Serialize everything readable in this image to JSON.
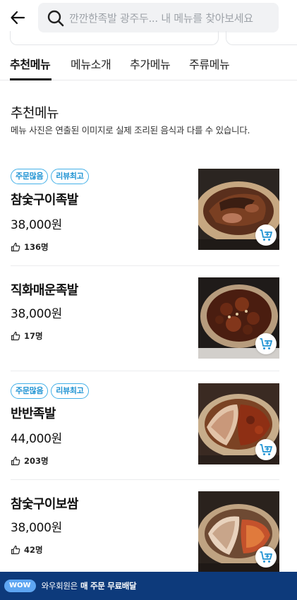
{
  "header": {
    "search_placeholder": "깐깐한족발 광주두... 내 메뉴를 찾아보세요"
  },
  "tabs": [
    {
      "label": "추천메뉴",
      "active": true
    },
    {
      "label": "메뉴소개",
      "active": false
    },
    {
      "label": "추가메뉴",
      "active": false
    },
    {
      "label": "주류메뉴",
      "active": false
    }
  ],
  "section": {
    "title": "추천메뉴",
    "description": "메뉴 사진은 연출된 이미지로 실제 조리된 음식과 다를 수 있습니다."
  },
  "menu_items": [
    {
      "badges": [
        "주문많음",
        "리뷰최고"
      ],
      "name": "참숯구이족발",
      "price": "38,000원",
      "likes": "136명"
    },
    {
      "badges": [],
      "name": "직화매운족발",
      "price": "38,000원",
      "likes": "17명"
    },
    {
      "badges": [
        "주문많음",
        "리뷰최고"
      ],
      "name": "반반족발",
      "price": "44,000원",
      "likes": "203명"
    },
    {
      "badges": [],
      "name": "참숯구이보쌈",
      "price": "38,000원",
      "likes": "42명"
    }
  ],
  "banner": {
    "badge": "WOW",
    "text": "와우회원은",
    "strong": "매 주문 무료배달"
  },
  "colors": {
    "accent_blue": "#1f93d3",
    "banner_bg": "#0d3a7b",
    "cart_icon": "#1f93d3"
  },
  "icons": {
    "back": "arrow-left-icon",
    "search": "search-icon",
    "like": "thumbs-up-icon",
    "cart": "add-to-cart-icon"
  }
}
